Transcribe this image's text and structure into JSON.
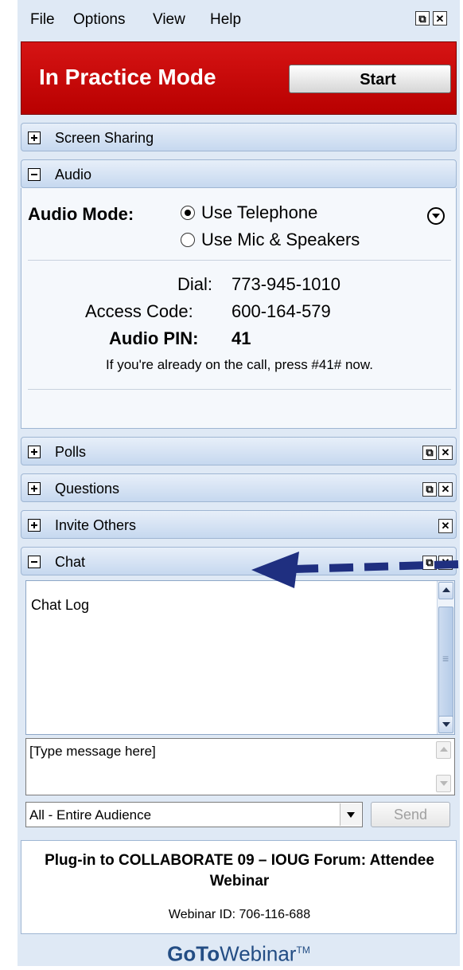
{
  "menu": {
    "file": "File",
    "options": "Options",
    "view": "View",
    "help": "Help"
  },
  "window_buttons": {
    "restore": "⧉",
    "close": "✕"
  },
  "practice": {
    "title": "In Practice Mode",
    "start_label": "Start"
  },
  "sections": {
    "screen_sharing": "Screen Sharing",
    "audio": "Audio",
    "polls": "Polls",
    "questions": "Questions",
    "invite": "Invite Others",
    "chat": "Chat"
  },
  "audio": {
    "mode_label": "Audio Mode:",
    "options": [
      "Use Telephone",
      "Use Mic & Speakers"
    ],
    "selected": "Use Telephone",
    "dial_label": "Dial:",
    "dial_value": "773-945-1010",
    "access_label": "Access Code:",
    "access_value": "600-164-579",
    "pin_label": "Audio PIN:",
    "pin_value": "41",
    "info": "If you're already on the call, press #41# now."
  },
  "chat": {
    "log_label": "Chat Log",
    "message_placeholder": "[Type message here]",
    "audience": "All - Entire Audience",
    "send_label": "Send"
  },
  "footer": {
    "title": "Plug-in to COLLABORATE 09 – IOUG Forum: Attendee Webinar",
    "webinar_id": "Webinar ID: 706-116-688",
    "brand_bold": "GoTo",
    "brand_light": "Webinar",
    "brand_tm": "TM"
  },
  "colors": {
    "practice_bar": "#c80000",
    "panel": "#dfe9f5",
    "arrow": "#1f2f80"
  }
}
